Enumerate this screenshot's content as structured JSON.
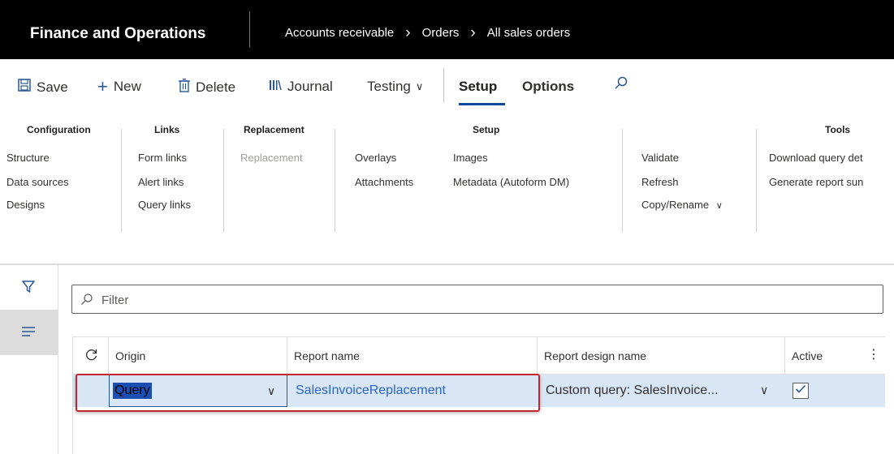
{
  "app": {
    "title": "Finance and Operations"
  },
  "breadcrumb": {
    "items": [
      "Accounts receivable",
      "Orders",
      "All sales orders"
    ]
  },
  "toolbar": {
    "save": "Save",
    "new": "New",
    "delete": "Delete",
    "journal": "Journal",
    "testing": "Testing",
    "setup": "Setup",
    "options": "Options"
  },
  "ribbon": {
    "configuration": {
      "header": "Configuration",
      "items": [
        "Structure",
        "Data sources",
        "Designs"
      ]
    },
    "links": {
      "header": "Links",
      "items": [
        "Form links",
        "Alert links",
        "Query links"
      ]
    },
    "replacement": {
      "header": "Replacement",
      "items": [
        "Replacement"
      ]
    },
    "extra": {
      "items": [
        "Overlays",
        "Attachments"
      ]
    },
    "setup": {
      "header": "Setup",
      "items": [
        "Images",
        "Metadata (Autoform DM)"
      ]
    },
    "validate_group": {
      "items": [
        "Validate",
        "Refresh",
        "Copy/Rename"
      ]
    },
    "tools": {
      "header": "Tools",
      "items": [
        "Download query det",
        "Generate report sun"
      ]
    }
  },
  "filter": {
    "placeholder": "Filter"
  },
  "grid": {
    "columns": [
      "Origin",
      "Report name",
      "Report design name",
      "Active"
    ],
    "rows": [
      {
        "origin": "Query",
        "report_name": "SalesInvoiceReplacement",
        "report_design_name": "Custom query: SalesInvoice...",
        "active": true
      }
    ]
  },
  "colors": {
    "accent": "#0f4a9c",
    "selected_row": "#d8e6f5",
    "highlight": "#c4262e",
    "link": "#2b66c8"
  }
}
